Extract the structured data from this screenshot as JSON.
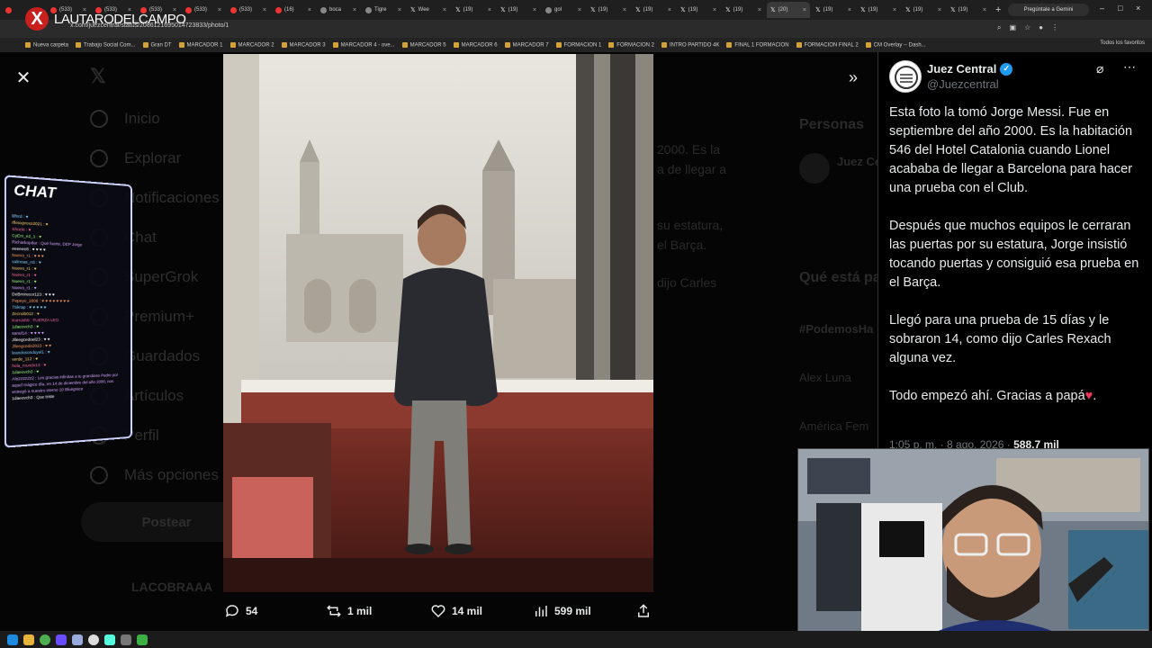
{
  "browser": {
    "tabs": [
      {
        "title": "",
        "icon": "youtube-icon"
      },
      {
        "title": "(533)",
        "icon": "youtube-icon"
      },
      {
        "title": "(533)",
        "icon": "youtube-icon"
      },
      {
        "title": "(533)",
        "icon": "youtube-icon"
      },
      {
        "title": "(533)",
        "icon": "youtube-icon"
      },
      {
        "title": "(533)",
        "icon": "youtube-icon"
      },
      {
        "title": "(16)",
        "icon": "youtube-icon"
      },
      {
        "title": "boca",
        "icon": "globe-icon"
      },
      {
        "title": "Tigre",
        "icon": "globe-icon"
      },
      {
        "title": "Wee",
        "icon": "x-icon"
      },
      {
        "title": "(19)",
        "icon": "x-icon"
      },
      {
        "title": "(19)",
        "icon": "x-icon"
      },
      {
        "title": "gol",
        "icon": "google-icon"
      },
      {
        "title": "(19)",
        "icon": "x-icon"
      },
      {
        "title": "(19)",
        "icon": "x-icon"
      },
      {
        "title": "(19)",
        "icon": "x-icon"
      },
      {
        "title": "(19)",
        "icon": "x-icon"
      },
      {
        "title": "(20)",
        "icon": "x-icon"
      },
      {
        "title": "(19)",
        "icon": "x-icon"
      },
      {
        "title": "(19)",
        "icon": "x-icon"
      },
      {
        "title": "(19)",
        "icon": "x-icon"
      },
      {
        "title": "(19)",
        "icon": "x-icon"
      }
    ],
    "active_tab_index": 17,
    "gemini_label": "Pregúntale a Gemini",
    "url": "x.com/juezcentral/status/2086121695014723833/photo/1",
    "bookmarks": [
      "Nueva carpeta",
      "Trabajo Social Com...",
      "Gran DT",
      "MARCADOR 1",
      "MARCADOR 2",
      "MARCADOR 3",
      "MARCADOR 4 - ove...",
      "MARCADOR 5",
      "MARCADOR 6",
      "MARCADOR 7",
      "FORMACION 1",
      "FORMACION 2",
      "INTRO PARTIDO 4K",
      "FINAL 1 FORMACION",
      "FORMACION FINAL 2",
      "CM Overlay -- Dash..."
    ],
    "all_favorites": "Todos los favoritos"
  },
  "stream": {
    "channel_name": "LAUTARODELCAMPO",
    "chat_title": "CHAT",
    "chat_lines": [
      "lilfnrd : ♥",
      "rflexxproxo2021 : ♥",
      "Shocki : ♥",
      "CyEm_e2_1 : ♥",
      "Richarkopdar : Qué fuerte, DEP Jorge",
      "eeeeee8 : ♥ ♥ ♥ ♥",
      "Nuevo_r1 : ♥ ♥ ♥",
      "valinnas_nS : ♥",
      "Nuevo_r1 : ♥",
      "Nuevo_r1 : ♥",
      "Nuevo_r1 : ♥",
      "Nuevo_r1 : ♥",
      "DeBmirecor123 : ♥ ♥ ♥",
      "Pepeyo_2006 : ♥ ♥ ♥ ♥ ♥ ♥ ♥ ♥",
      "7Skrap : ♥ ♥ ♥ ♥ ♥",
      "Zecnob012 : ♥",
      "Kurrush9 : FUERZA LEO",
      "1daeovch3 : ♥",
      "sanul14 : ♥ ♥ ♥ ♥",
      "Jlleegcedoel23 : ♥ ♥",
      "Jlleegcedo2023 : ♥ ♥",
      "leandosonduyel1 : ♥",
      "verde_112 : ♥",
      "hola_mundo13 : ♥",
      "1daeovch3 : ♥",
      "Ale2z2z2z2 : Les gracias infinitas a tu grandioso Padre por aquel mágico día, en 14 de diciembre del año 2000, nos entregó a nuestro eterno 10 Bluegrace",
      "1daeovch3 : Que triste"
    ]
  },
  "x_background": {
    "nav": [
      "Inicio",
      "Explorar",
      "Notificaciones",
      "Chat",
      "SuperGrok",
      "Premium+",
      "Guardados",
      "Artículos",
      "Perfil",
      "Más opciones"
    ],
    "post_button": "Postear",
    "bottom_user": "LACOBRAAA",
    "right_headers": [
      "Personas",
      "Qué está pasando"
    ],
    "right_items": [
      "Juez Central",
      "#PodemosHa",
      "Alex Luna",
      "América Fem"
    ],
    "partial_text": [
      "2000. Es la",
      "a de llegar a",
      "su estatura,",
      "el Barça.",
      "dijo Carles"
    ]
  },
  "tweet": {
    "display_name": "Juez Central",
    "handle": "@Juezcentral",
    "paragraphs": [
      "Esta foto la tomó Jorge Messi. Fue en septiembre del año 2000. Es la habitación 546 del Hotel Catalonia cuando Lionel acababa de llegar a Barcelona para hacer una prueba con el Club.",
      "Después que muchos equipos le cerraran las puertas por su estatura, Jorge insistió tocando puertas y consiguió esa prueba en el Barça.",
      "Llegó para una prueba de 15 días y le sobraron 14, como dijo Carles Rexach alguna vez."
    ],
    "last_paragraph": "Todo empezó ahí. Gracias a papá",
    "last_emoji": "♥",
    "timestamp": "1:05 p. m. · 8 ago. 2026 ·",
    "views": "588,7 mil"
  },
  "actions": {
    "replies": "54",
    "reposts": "1 mil",
    "likes": "14 mil",
    "views": "599 mil"
  },
  "colors": {
    "verified": "#1d9bf0",
    "like_red": "#f0345c",
    "channel_red": "#c81f1f"
  }
}
